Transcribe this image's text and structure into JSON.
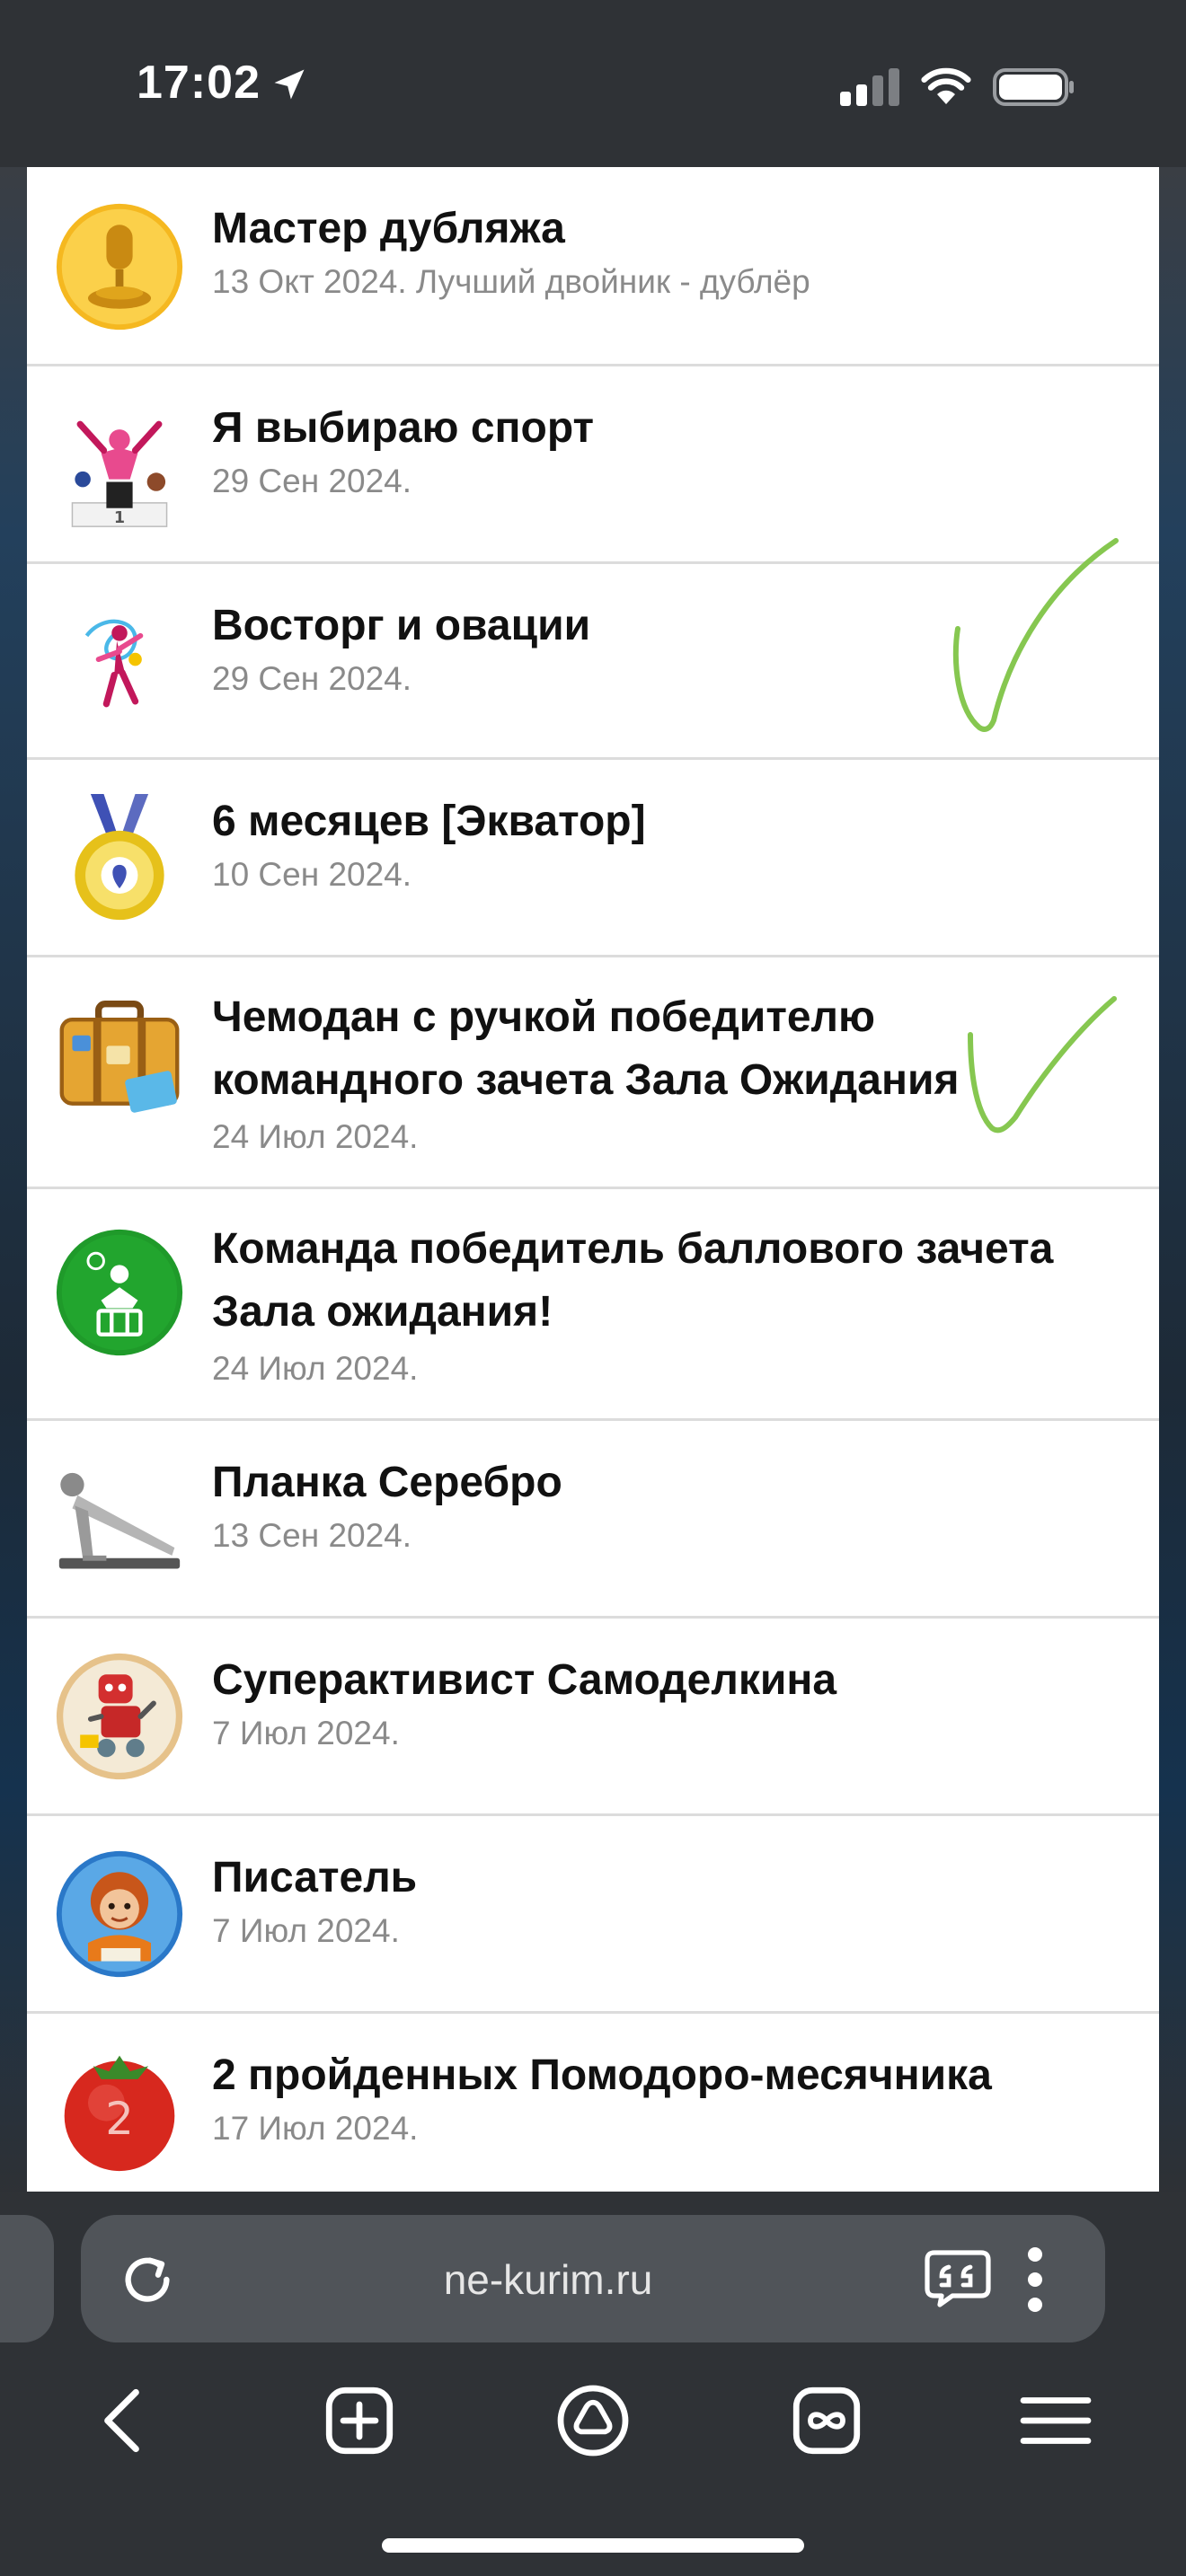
{
  "status_bar": {
    "time": "17:02"
  },
  "items": [
    {
      "title": "Мастер дубляжа",
      "date": "13 Окт 2024. Лучший двойник - дублёр",
      "icon": "golden-microphone-award-icon"
    },
    {
      "title": "Я выбираю спорт",
      "date": "29 Сен 2024.",
      "icon": "sports-podium-icon"
    },
    {
      "title": "Восторг и овации",
      "date": "29 Сен 2024.",
      "icon": "gymnast-ribbon-icon"
    },
    {
      "title": "6 месяцев [Экватор]",
      "date": "10 Сен 2024.",
      "icon": "gold-medal-icon"
    },
    {
      "title": "Чемодан с ручкой победителю командного зачета Зала Ожидания",
      "date": "24 Июл 2024.",
      "icon": "suitcase-icon"
    },
    {
      "title": "Команда победитель баллового зачета Зала ожидания!",
      "date": "24 Июл 2024.",
      "icon": "green-team-badge-icon"
    },
    {
      "title": "Планка Серебро",
      "date": "13 Сен 2024.",
      "icon": "plank-exercise-icon"
    },
    {
      "title": "Суперактивист Самоделкина",
      "date": "7 Июл 2024.",
      "icon": "robot-activist-icon"
    },
    {
      "title": "Писатель",
      "date": "7 Июл 2024.",
      "icon": "writer-child-icon"
    },
    {
      "title": "2 пройденных Помодоро-месячника",
      "date": "17 Июл 2024.",
      "icon": "tomato-icon",
      "badge": "2"
    }
  ],
  "browser": {
    "url": "ne-kurim.ru"
  },
  "colors": {
    "check_green": "#86c750",
    "background": "#2f3236",
    "url_bar": "#505459"
  }
}
